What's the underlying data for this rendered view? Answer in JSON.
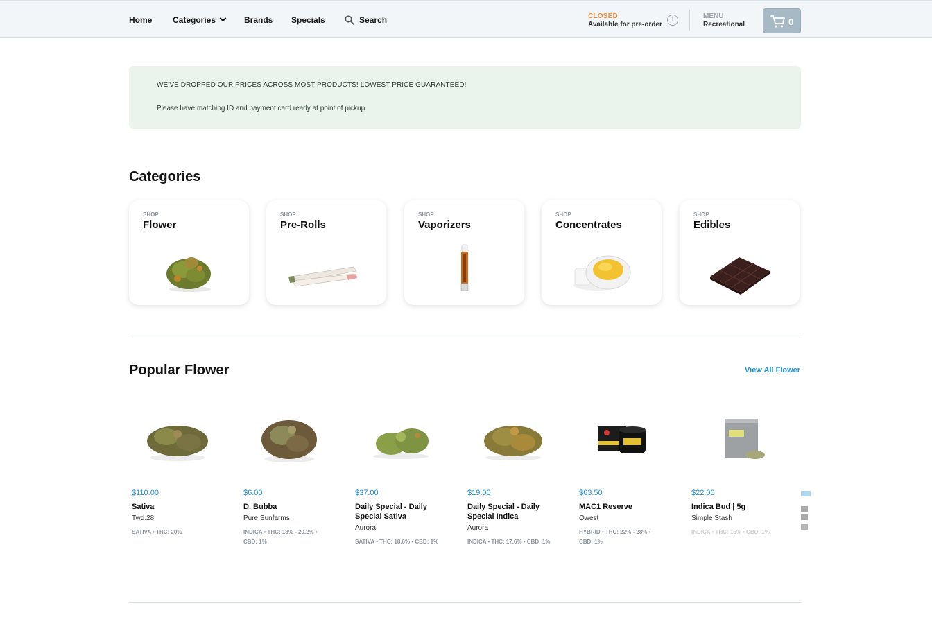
{
  "nav": {
    "home": "Home",
    "categories": "Categories",
    "brands": "Brands",
    "specials": "Specials",
    "search": "Search",
    "status": "CLOSED",
    "status_sub": "Available for pre-order",
    "menu_label": "MENU",
    "menu_value": "Recreational",
    "cart_count": "0"
  },
  "banner": {
    "line1": "WE'VE DROPPED OUR PRICES ACROSS MOST PRODUCTS! LOWEST PRICE GUARANTEED!",
    "line2": "Please have matching ID and payment card ready at point of pickup."
  },
  "categories": {
    "title": "Categories",
    "items": [
      {
        "shop": "SHOP",
        "name": "Flower"
      },
      {
        "shop": "SHOP",
        "name": "Pre-Rolls"
      },
      {
        "shop": "SHOP",
        "name": "Vaporizers"
      },
      {
        "shop": "SHOP",
        "name": "Concentrates"
      },
      {
        "shop": "SHOP",
        "name": "Edibles"
      }
    ]
  },
  "popular": {
    "title": "Popular Flower",
    "view_all": "View All Flower",
    "products": [
      {
        "price": "$110.00",
        "name": "Sativa",
        "brand": "Twd.28",
        "tags": "SATIVA • THC: 20%"
      },
      {
        "price": "$6.00",
        "name": "D. Bubba",
        "brand": "Pure Sunfarms",
        "tags": "INDICA • THC: 18% - 20.2% • CBD: 1%"
      },
      {
        "price": "$37.00",
        "name": "Daily Special - Daily Special Sativa",
        "brand": "Aurora",
        "tags": "SATIVA • THC: 18.6% • CBD: 1%"
      },
      {
        "price": "$19.00",
        "name": "Daily Special - Daily Special Indica",
        "brand": "Aurora",
        "tags": "INDICA • THC: 17.6% • CBD: 1%"
      },
      {
        "price": "$63.50",
        "name": "MAC1 Reserve",
        "brand": "Qwest",
        "tags": "HYBRID • THC: 22% - 28% • CBD: 1%"
      },
      {
        "price": "$22.00",
        "name": "Indica Bud | 5g",
        "brand": "Simple Stash",
        "tags": "INDICA • THC: 15% • CBD: 1%"
      }
    ]
  },
  "colors": {
    "accent": "#1e8fd0",
    "closed": "#f08a3b",
    "banner_bg": "#ebf4ec",
    "cart_bg": "#a8b9c6"
  }
}
